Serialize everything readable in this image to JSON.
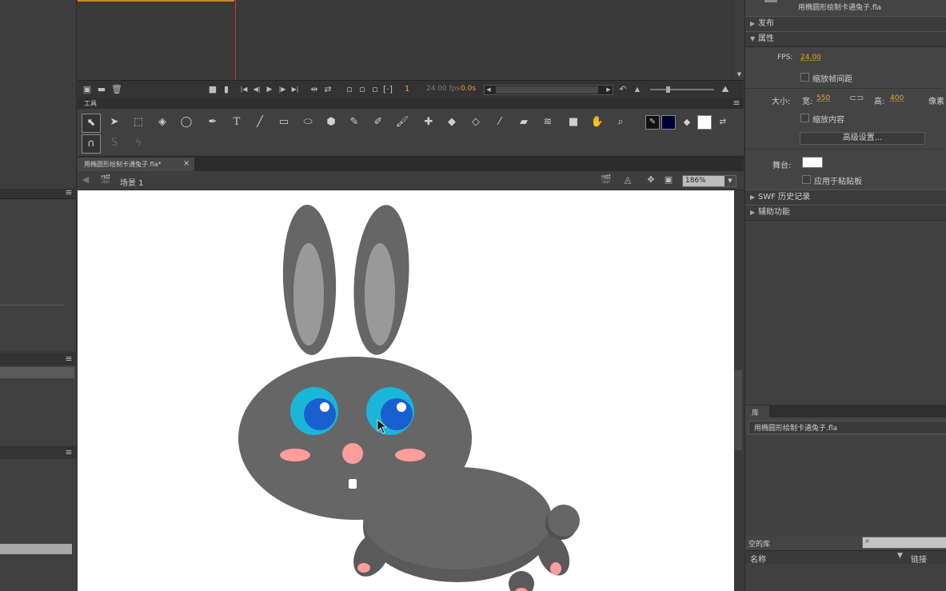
{
  "timeline": {
    "fps_readout": "24.00 fps",
    "time_readout": "0.0s",
    "frame_number": "1"
  },
  "tools_panel": {
    "title": "工具"
  },
  "document": {
    "tab_label": "用椭圆形绘制卡通兔子.fla*",
    "tab_close": "×",
    "scene_label": "场景 1",
    "zoom": "186%"
  },
  "properties": {
    "doc_name": "用椭圆形绘制卡通兔子.fla",
    "publish_label": "发布",
    "props_label": "属性",
    "fps_label": "FPS:",
    "fps_value": "24.00",
    "scale_spans_label": "缩放帧间距",
    "size_label": "大小:",
    "width_label": "宽:",
    "width_value": "550",
    "height_label": "高:",
    "height_value": "400",
    "unit_label": "像素",
    "scale_content_label": "缩放内容",
    "advanced_button": "高级设置...",
    "stage_label": "舞台:",
    "apply_paste_label": "应用于粘贴板",
    "swf_history_label": "SWF 历史记录",
    "accessibility_label": "辅助功能"
  },
  "library": {
    "tab_label": "库",
    "doc_select": "用椭圆形绘制卡通兔子.fla",
    "empty_label": "空的库",
    "col_name": "名称",
    "col_link": "链接"
  },
  "colors": {
    "stroke": "#111111",
    "fill": "#000033",
    "stage": "#ffffff",
    "accent": "#e8a33a"
  }
}
